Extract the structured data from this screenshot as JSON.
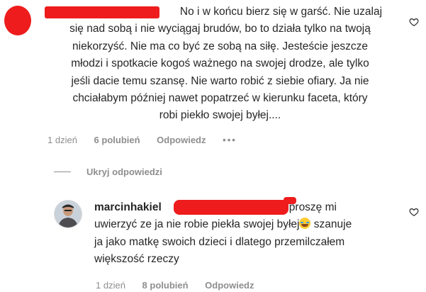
{
  "comment1": {
    "lines": [
      "No i w końcu bierz się w garść. Nie uzalaj",
      "się nad sobą i nie wyciągaj brudów, bo to działa tylko na twoją",
      "niekorzyść. Nie ma co być ze sobą na siłę. Jesteście jeszcze",
      "młodzi i spotkacie kogoś ważnego na swojej drodze, ale tylko",
      "jeśli dacie temu szansę. Nie warto robić z siebie ofiary. Ja nie",
      "chciałabym później nawet popatrzeć w kierunku faceta, który",
      "robi piekło swojej byłej...."
    ],
    "time": "1 dzień",
    "likes": "6 polubień",
    "reply": "Odpowiedz",
    "more": "•••"
  },
  "hide_replies": "Ukryj odpowiedzi",
  "comment2": {
    "username": "marcinhakiel",
    "line1_tail": "proszę mi",
    "line2_before_emoji": "uwierzyć ze ja nie robie piekła swojej byłej",
    "line2_after_emoji": " szanuje",
    "line3": "ja jako matkę swoich dzieci i dlatego przemilczałem",
    "line4": "większość rzeczy",
    "time": "1 dzień",
    "likes": "8 polubień",
    "reply": "Odpowiedz"
  },
  "colors": {
    "redaction": "#ee1c1c",
    "text": "#262626",
    "muted": "#8e8e8e"
  },
  "icons": [
    "heart-outline-icon",
    "more-options-icon",
    "grinning-tears-emoji"
  ]
}
